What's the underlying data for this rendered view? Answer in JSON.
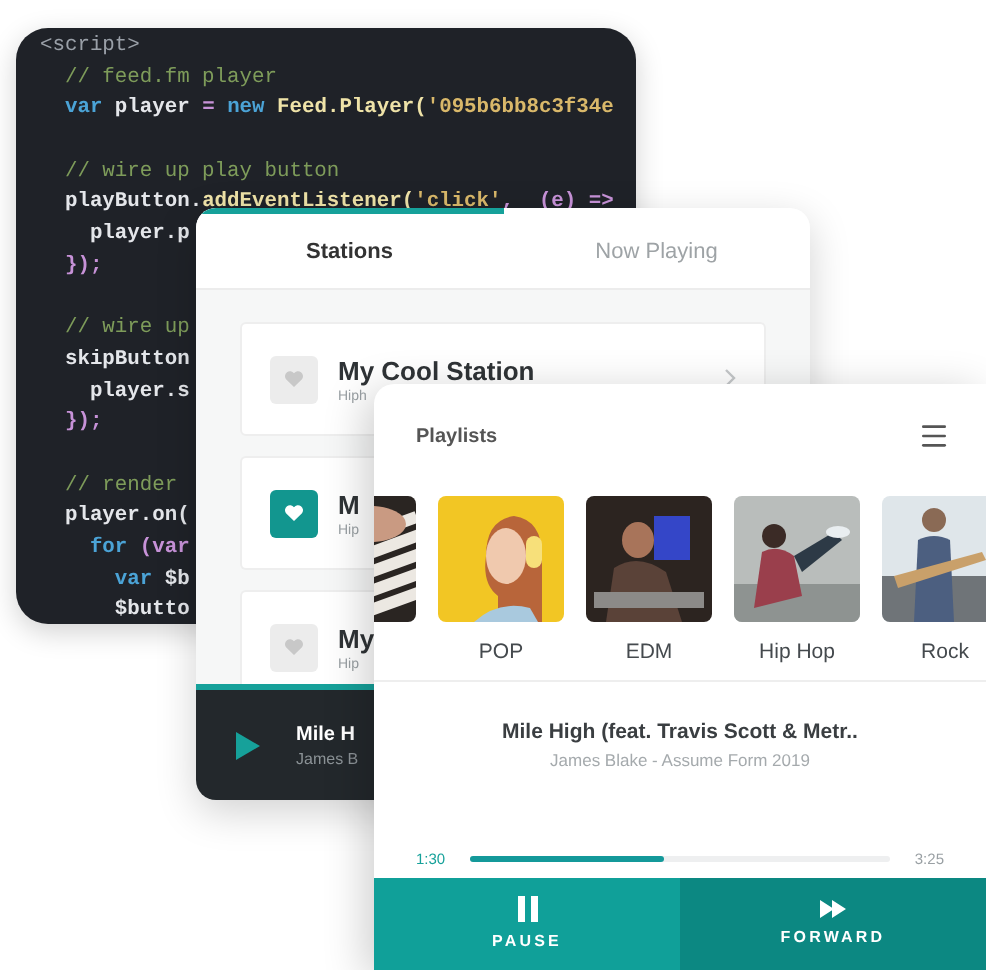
{
  "code_editor": {
    "lines": [
      {
        "kind": "code",
        "tokens": [
          {
            "kind": "tag",
            "text": "<script>"
          }
        ]
      },
      {
        "kind": "code",
        "tokens": [
          {
            "kind": "comment",
            "text": "  // feed.fm player"
          }
        ]
      },
      {
        "kind": "code",
        "tokens": [
          {
            "kind": "keyword",
            "text": "  var "
          },
          {
            "kind": "ident",
            "text": "player "
          },
          {
            "kind": "punct",
            "text": "= "
          },
          {
            "kind": "keyword",
            "text": "new "
          },
          {
            "kind": "func",
            "text": "Feed.Player("
          },
          {
            "kind": "string",
            "text": "'095b6bb8c3f34e"
          }
        ]
      },
      {
        "kind": "blank"
      },
      {
        "kind": "code",
        "tokens": [
          {
            "kind": "comment",
            "text": "  // wire up play button"
          }
        ]
      },
      {
        "kind": "code",
        "tokens": [
          {
            "kind": "ident",
            "text": "  playButton."
          },
          {
            "kind": "func",
            "text": "addEventListener("
          },
          {
            "kind": "string",
            "text": "'click'"
          },
          {
            "kind": "punct",
            "text": ",  (e) =>"
          }
        ]
      },
      {
        "kind": "code",
        "tokens": [
          {
            "kind": "ident",
            "text": "    player.p"
          }
        ]
      },
      {
        "kind": "code",
        "tokens": [
          {
            "kind": "punct",
            "text": "  });"
          }
        ]
      },
      {
        "kind": "blank"
      },
      {
        "kind": "code",
        "tokens": [
          {
            "kind": "comment",
            "text": "  // wire up"
          }
        ]
      },
      {
        "kind": "code",
        "tokens": [
          {
            "kind": "ident",
            "text": "  skipButton"
          }
        ]
      },
      {
        "kind": "code",
        "tokens": [
          {
            "kind": "ident",
            "text": "    player.s"
          }
        ]
      },
      {
        "kind": "code",
        "tokens": [
          {
            "kind": "punct",
            "text": "  });"
          }
        ]
      },
      {
        "kind": "blank"
      },
      {
        "kind": "code",
        "tokens": [
          {
            "kind": "comment",
            "text": "  // render"
          }
        ]
      },
      {
        "kind": "code",
        "tokens": [
          {
            "kind": "ident",
            "text": "  player.on("
          }
        ]
      },
      {
        "kind": "code",
        "tokens": [
          {
            "kind": "keyword",
            "text": "    for "
          },
          {
            "kind": "punct",
            "text": "(var"
          }
        ]
      },
      {
        "kind": "code",
        "tokens": [
          {
            "kind": "keyword",
            "text": "      var "
          },
          {
            "kind": "ident",
            "text": "$b"
          }
        ]
      },
      {
        "kind": "code",
        "tokens": [
          {
            "kind": "ident",
            "text": "      $butto"
          }
        ]
      }
    ]
  },
  "stations_window": {
    "tabs": [
      {
        "label": "Stations",
        "selected": true
      },
      {
        "label": "Now Playing",
        "selected": false
      }
    ],
    "stations": [
      {
        "title": "My Cool Station",
        "subtitle": "Hiph",
        "favorite": false
      },
      {
        "title": "M",
        "subtitle": "Hip",
        "favorite": true
      },
      {
        "title": "My",
        "subtitle": "Hip",
        "favorite": false
      }
    ],
    "mini_player": {
      "title": "Mile H",
      "artist": "James B"
    }
  },
  "playlists_window": {
    "title": "Playlists",
    "playlists": [
      {
        "kind": "picture"
      },
      {
        "kind": "picture",
        "label": "POP"
      },
      {
        "kind": "picture",
        "label": "EDM"
      },
      {
        "kind": "picture",
        "label": "Hip Hop"
      },
      {
        "kind": "picture",
        "label": "Rock"
      }
    ],
    "now_playing": {
      "title": "Mile High (feat. Travis Scott & Metr..",
      "artist": "James Blake - Assume Form 2019",
      "elapsed": "1:30",
      "duration": "3:25",
      "level": 0.46
    },
    "buttons": [
      {
        "label": "PAUSE",
        "kind": "pause"
      },
      {
        "label": "FORWARD",
        "kind": "forward"
      }
    ]
  }
}
